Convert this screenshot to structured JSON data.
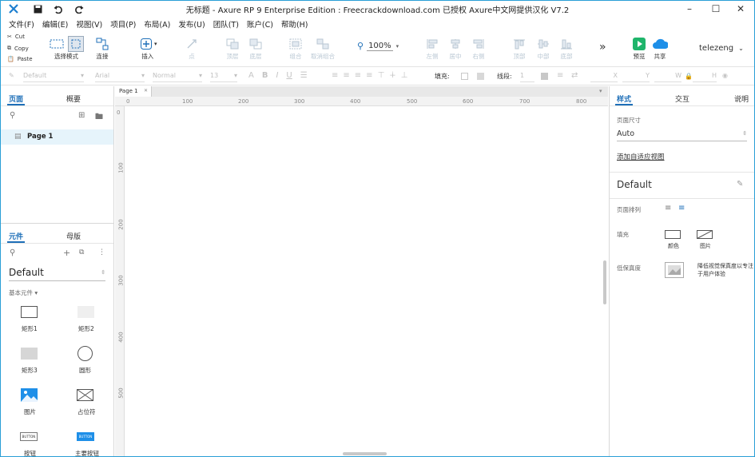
{
  "titlebar": {
    "title": "无标题 - Axure RP 9 Enterprise Edition : Freecrackdownload.com 已授权    Axure中文网提供汉化 V7.2"
  },
  "menu": [
    "文件(F)",
    "编辑(E)",
    "视图(V)",
    "项目(P)",
    "布局(A)",
    "发布(U)",
    "团队(T)",
    "账户(C)",
    "帮助(H)"
  ],
  "clipboard": {
    "cut": "Cut",
    "copy": "Copy",
    "paste": "Paste"
  },
  "toolbar": {
    "select_mode": "选择模式",
    "connect": "连接",
    "insert": "插入",
    "point": "点",
    "top": "顶层",
    "bottom": "底层",
    "group": "组合",
    "ungroup": "取消组合",
    "zoom": "100%",
    "align_left": "左侧",
    "align_center": "居中",
    "align_right": "右侧",
    "align_top": "顶部",
    "align_middle": "中部",
    "align_bottom": "底部",
    "preview": "预览",
    "share": "共享",
    "user": "telezeng",
    "more": "»"
  },
  "formatbar": {
    "style": "Default",
    "font": "Arial",
    "weight": "Normal",
    "size": "13",
    "fill_label": "填充:",
    "line_label": "线段:",
    "line_val": "1",
    "x_label": "X",
    "y_label": "Y",
    "w_label": "W",
    "h_label": "H"
  },
  "pages_panel": {
    "tab_pages": "页面",
    "tab_outline": "概要",
    "page_item": "Page 1"
  },
  "widgets_panel": {
    "tab_widgets": "元件",
    "tab_masters": "母版",
    "library": "Default",
    "category": "基本元件 ▾",
    "items": [
      "矩形1",
      "矩形2",
      "矩形3",
      "圆形",
      "图片",
      "占位符",
      "按钮",
      "主要按钮"
    ],
    "button_text": "BUTTON"
  },
  "canvas": {
    "tab": "Page 1",
    "ruler_h": [
      "0",
      "100",
      "200",
      "300",
      "400",
      "500",
      "600",
      "700",
      "800"
    ],
    "ruler_v": [
      "0",
      "100",
      "200",
      "300",
      "400",
      "500"
    ]
  },
  "right_panel": {
    "tab_style": "样式",
    "tab_interact": "交互",
    "tab_notes": "说明",
    "page_size_label": "页面尺寸",
    "page_size_value": "Auto",
    "add_adaptive": "添加自适应视图",
    "style_name": "Default",
    "page_align_label": "页面排列",
    "fill_label": "填充",
    "fill_color": "颜色",
    "fill_image": "图片",
    "lofi_label": "低保真度",
    "lofi_desc": "降低视觉保真度以专注于用户体验"
  },
  "colors": {
    "accent": "#1e6fb8",
    "window_border": "#2a9fd6",
    "preview_green": "#1fb56b",
    "share_blue": "#1e8fe8"
  }
}
